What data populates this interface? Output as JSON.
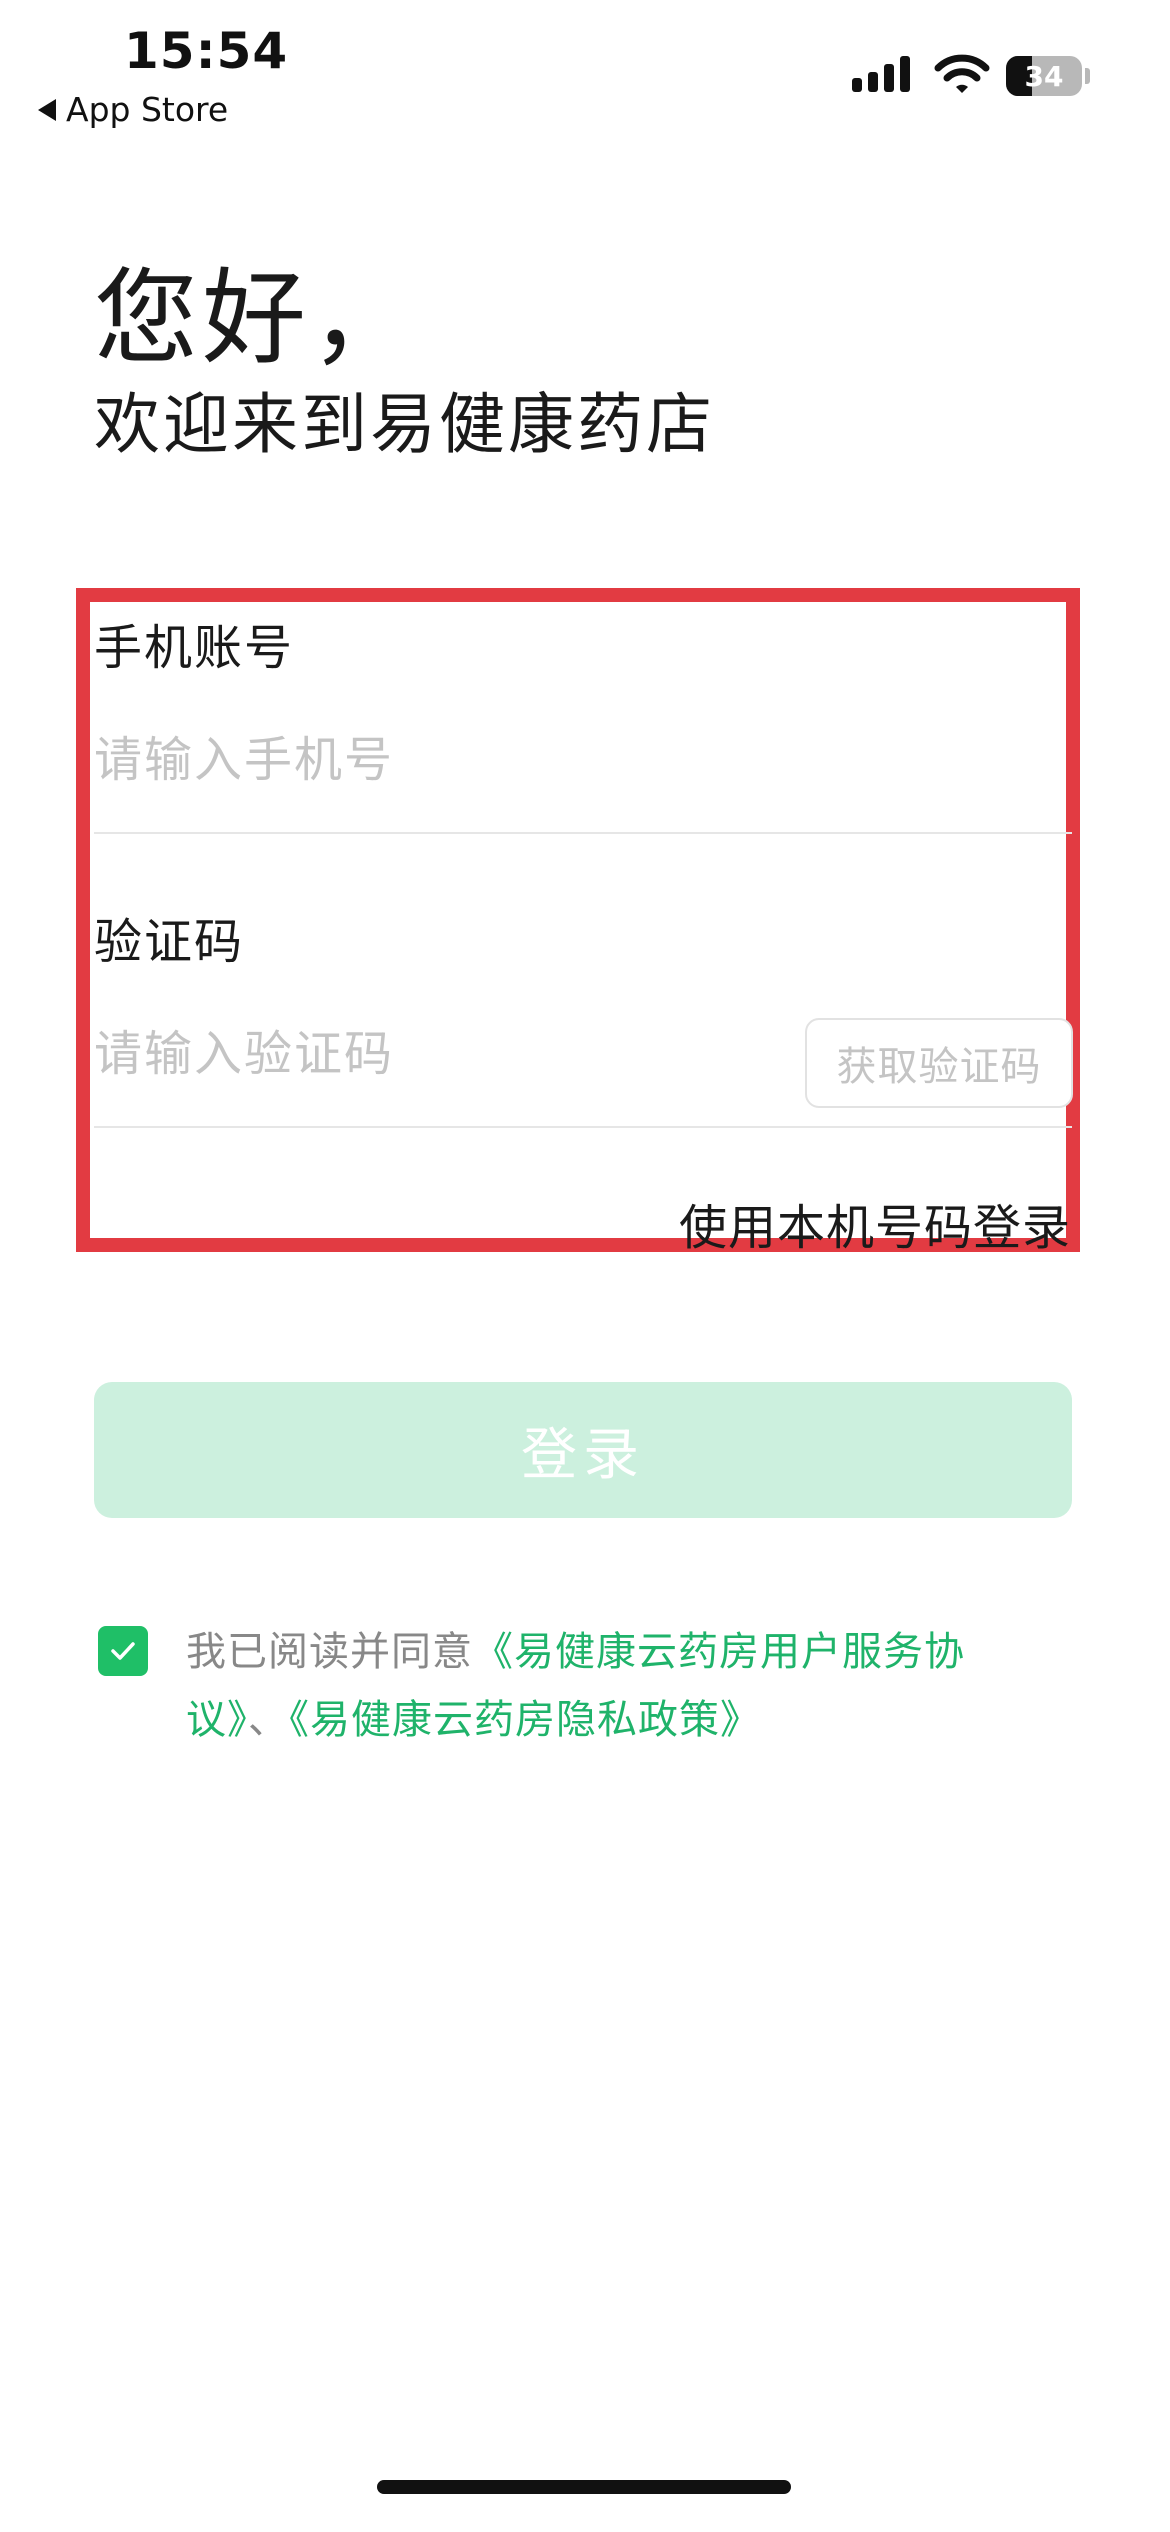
{
  "status_bar": {
    "time": "15:54",
    "back_label": "App Store",
    "battery_text": "34",
    "battery_level": 0.34
  },
  "greeting": {
    "title": "您好，",
    "subtitle": "欢迎来到易健康药店"
  },
  "form": {
    "phone_label": "手机账号",
    "phone_placeholder": "请输入手机号",
    "code_label": "验证码",
    "code_placeholder": "请输入验证码",
    "get_code_label": "获取验证码",
    "local_login_label": "使用本机号码登录"
  },
  "login_button_label": "登录",
  "agreement": {
    "checked": true,
    "prefix": "我已阅读并同意",
    "service_link": "《易健康云药房用户服务协议》",
    "separator": "、",
    "privacy_link": "《易健康云药房隐私政策》"
  },
  "colors": {
    "accent_green": "#1fb36a",
    "highlight_red": "#e23b42",
    "login_button_disabled": "#ccf0de"
  }
}
